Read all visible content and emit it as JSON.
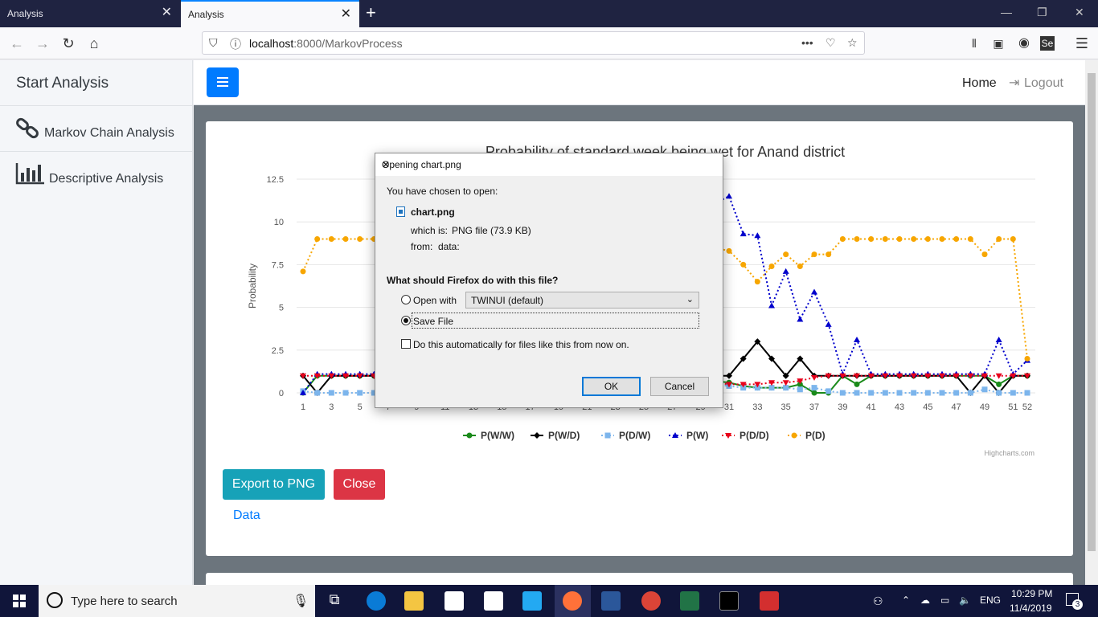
{
  "browser": {
    "tabs": [
      {
        "label": "Analysis",
        "active": false
      },
      {
        "label": "Analysis",
        "active": true
      }
    ],
    "url_host": "localhost",
    "url_rest": ":8000/MarkovProcess"
  },
  "sidebar": {
    "title": "Start Analysis",
    "items": [
      {
        "label": "Markov Chain Analysis",
        "icon": "link-icon"
      },
      {
        "label": "Descriptive Analysis",
        "icon": "bar-chart-icon"
      }
    ]
  },
  "topnav": {
    "home": "Home",
    "logout": "Logout"
  },
  "actions": {
    "export": "Export to PNG",
    "close": "Close",
    "data_link": "Data"
  },
  "chart_data": {
    "type": "line",
    "title": "Probability of standard week being wet for Anand district",
    "ylabel": "Probability",
    "xlabel": "",
    "ylim": [
      0,
      12.5
    ],
    "yticks": [
      "0",
      "2.5",
      "5",
      "7.5",
      "10",
      "12.5"
    ],
    "xticks": [
      "1",
      "3",
      "5",
      "7",
      "9",
      "11",
      "13",
      "15",
      "17",
      "19",
      "21",
      "23",
      "25",
      "27",
      "29",
      "31",
      "33",
      "35",
      "37",
      "39",
      "41",
      "43",
      "45",
      "47",
      "49",
      "51",
      "52"
    ],
    "credits": "Highcharts.com",
    "colors": {
      "PWW": "#1a8a1a",
      "PWD": "#000000",
      "PDW": "#7cb5ec",
      "PW": "#0000cc",
      "PDD": "#e8001c",
      "PD": "#f7a600"
    },
    "series": [
      {
        "name": "P(W/W)",
        "x": [
          1,
          2,
          3,
          4,
          5,
          6,
          29,
          30,
          31,
          32,
          33,
          34,
          35,
          36,
          37,
          38,
          39,
          40,
          41,
          42,
          43,
          44,
          45,
          46,
          47,
          48,
          49,
          50,
          51,
          52
        ],
        "values": [
          0,
          1,
          1,
          1,
          1,
          1,
          0.8,
          0.7,
          0.6,
          0.4,
          0.3,
          0.3,
          0.3,
          0.5,
          0,
          0,
          1,
          0.5,
          1,
          1,
          1,
          1,
          1,
          1,
          1,
          1,
          1,
          0.5,
          1,
          1
        ]
      },
      {
        "name": "P(W/D)",
        "x": [
          1,
          2,
          3,
          4,
          5,
          6,
          29,
          30,
          31,
          32,
          33,
          34,
          35,
          36,
          37,
          38,
          39,
          40,
          41,
          42,
          43,
          44,
          45,
          46,
          47,
          48,
          49,
          50,
          51,
          52
        ],
        "values": [
          1,
          0,
          1,
          1,
          1,
          1,
          1,
          1,
          1,
          2,
          3,
          2,
          1,
          2,
          1,
          1,
          1,
          1,
          1,
          1,
          1,
          1,
          1,
          1,
          1,
          0,
          1,
          0,
          1,
          1
        ]
      },
      {
        "name": "P(D/W)",
        "x": [
          1,
          2,
          3,
          4,
          5,
          6,
          29,
          30,
          31,
          32,
          33,
          34,
          35,
          36,
          37,
          38,
          39,
          40,
          41,
          42,
          43,
          44,
          45,
          46,
          47,
          48,
          49,
          50,
          51,
          52
        ],
        "values": [
          0.1,
          0,
          0,
          0,
          0,
          0,
          0.5,
          0.5,
          0.4,
          0.3,
          0.3,
          0.3,
          0.3,
          0.2,
          0.3,
          0.1,
          0,
          0,
          0,
          0,
          0,
          0,
          0,
          0,
          0,
          0,
          0.2,
          0,
          0,
          0
        ]
      },
      {
        "name": "P(W)",
        "x": [
          1,
          2,
          3,
          4,
          5,
          6,
          31,
          32,
          33,
          34,
          35,
          36,
          37,
          38,
          39,
          40,
          41,
          42,
          43,
          44,
          45,
          46,
          47,
          48,
          49,
          50,
          51,
          52
        ],
        "values": [
          0,
          1.1,
          1.1,
          1.1,
          1.1,
          1.1,
          11.5,
          9.3,
          9.2,
          5.1,
          7.1,
          4.3,
          5.9,
          4,
          1.1,
          3.1,
          1.1,
          1.1,
          1.1,
          1.1,
          1.1,
          1.1,
          1.1,
          1.1,
          1.1,
          3.1,
          1.1,
          1.9
        ]
      },
      {
        "name": "P(D/D)",
        "x": [
          1,
          2,
          3,
          4,
          5,
          6,
          29,
          30,
          31,
          32,
          33,
          34,
          35,
          36,
          37,
          38,
          39,
          40,
          41,
          42,
          43,
          44,
          45,
          46,
          47,
          48,
          49,
          50,
          51,
          52
        ],
        "values": [
          1,
          1,
          1,
          1,
          1,
          1,
          0.7,
          0.6,
          0.5,
          0.5,
          0.5,
          0.6,
          0.6,
          0.7,
          0.9,
          1,
          1,
          1,
          1,
          1,
          1,
          1,
          1,
          1,
          1,
          1,
          1,
          1,
          1,
          1
        ]
      },
      {
        "name": "P(D)",
        "x": [
          1,
          2,
          3,
          4,
          5,
          6,
          30,
          31,
          32,
          33,
          34,
          35,
          36,
          37,
          38,
          39,
          40,
          41,
          42,
          43,
          44,
          45,
          46,
          47,
          48,
          49,
          50,
          51,
          52
        ],
        "values": [
          7.1,
          9,
          9,
          9,
          9,
          9,
          8.5,
          8.3,
          7.5,
          6.5,
          7.4,
          8.1,
          7.4,
          8.1,
          8.1,
          9,
          9,
          9,
          9,
          9,
          9,
          9,
          9,
          9,
          9,
          8.1,
          9,
          9,
          2
        ]
      }
    ]
  },
  "dialog": {
    "title": "Opening chart.png",
    "chosen": "You have chosen to open:",
    "filename": "chart.png",
    "which_is_label": "which is:",
    "which_is_value": "PNG file (73.9 KB)",
    "from_label": "from:",
    "from_value": "data:",
    "question": "What should Firefox do with this file?",
    "open_with": "Open with",
    "open_with_app": "TWINUI (default)",
    "save_file": "Save File",
    "auto": "Do this automatically for files like this from now on.",
    "ok": "OK",
    "cancel": "Cancel"
  },
  "taskbar": {
    "search_placeholder": "Type here to search",
    "lang": "ENG",
    "time": "10:29 PM",
    "date": "11/4/2019",
    "notifications": "3"
  }
}
